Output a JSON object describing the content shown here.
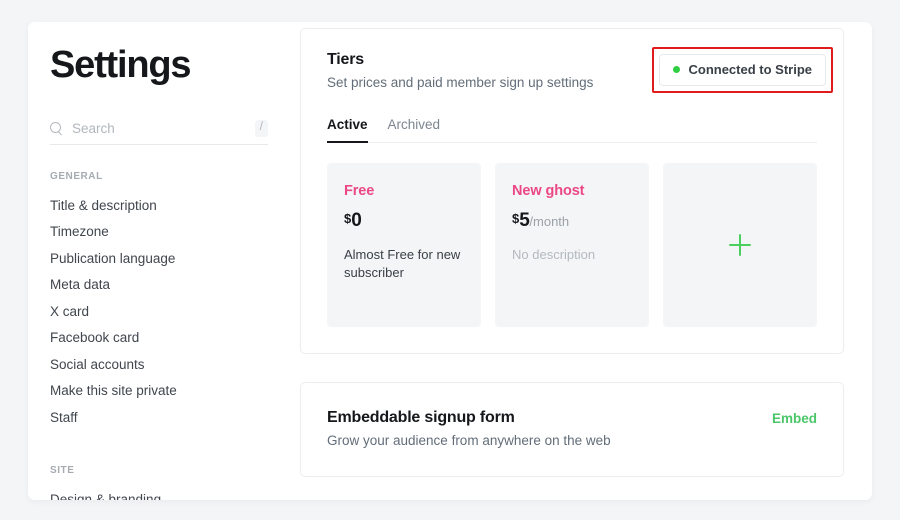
{
  "sidebar": {
    "title": "Settings",
    "search": {
      "placeholder": "Search",
      "value": "",
      "shortcut": "/",
      "icon": "search-icon"
    },
    "groups": [
      {
        "label": "GENERAL",
        "items": [
          "Title & description",
          "Timezone",
          "Publication language",
          "Meta data",
          "X card",
          "Facebook card",
          "Social accounts",
          "Make this site private",
          "Staff"
        ]
      },
      {
        "label": "SITE",
        "items": [
          "Design & branding"
        ]
      }
    ]
  },
  "tiers_card": {
    "title": "Tiers",
    "subtitle": "Set prices and paid member sign up settings",
    "stripe_status": {
      "label": "Connected to Stripe",
      "dot_icon": "status-dot-icon",
      "dot_color": "#30cf43",
      "highlighted": true,
      "highlight_color": "#e01b1b"
    },
    "tabs": [
      {
        "label": "Active",
        "active": true
      },
      {
        "label": "Archived",
        "active": false
      }
    ],
    "tiers": [
      {
        "name": "Free",
        "currency": "$",
        "amount": "0",
        "period": "",
        "description": "Almost Free for new subscriber",
        "description_muted": false
      },
      {
        "name": "New ghost",
        "currency": "$",
        "amount": "5",
        "period": "/month",
        "description": "No description",
        "description_muted": true
      }
    ],
    "add_tier": {
      "icon": "plus-icon",
      "color": "#4bcf5f"
    }
  },
  "embed_card": {
    "title": "Embeddable signup form",
    "subtitle": "Grow your audience from anywhere on the web",
    "action_label": "Embed",
    "action_color": "#4bc76a"
  },
  "theme": {
    "accent_pink": "#ec4786",
    "accent_green": "#30cf43",
    "text_dark": "#15171a",
    "text_muted": "#626d79",
    "page_bg": "#f4f5f7",
    "panel_bg": "#ffffff"
  }
}
